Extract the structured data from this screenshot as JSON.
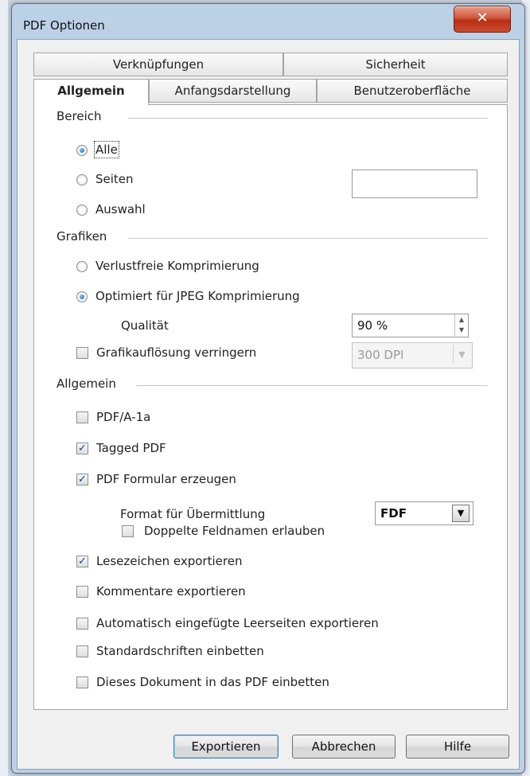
{
  "window": {
    "title": "PDF Optionen",
    "close_glyph": "✕"
  },
  "tabs": {
    "row1": [
      "Verknüpfungen",
      "Sicherheit"
    ],
    "row2": [
      "Allgemein",
      "Anfangsdarstellung",
      "Benutzeroberfläche"
    ],
    "active": "Allgemein"
  },
  "bereich": {
    "title": "Bereich",
    "alle": "Alle",
    "seiten": "Seiten",
    "auswahl": "Auswahl",
    "selected": "Alle",
    "seiten_value": ""
  },
  "grafiken": {
    "title": "Grafiken",
    "verlustfrei": "Verlustfreie Komprimierung",
    "jpeg": "Optimiert für JPEG Komprimierung",
    "selected": "jpeg",
    "qualitaet_label": "Qualität",
    "qualitaet_value": "90 %",
    "aufloesung_label": "Grafikauflösung verringern",
    "aufloesung_checked": false,
    "aufloesung_value": "300 DPI"
  },
  "allgemein": {
    "title": "Allgemein",
    "pdfa": {
      "label": "PDF/A-1a",
      "checked": false
    },
    "tagged": {
      "label": "Tagged PDF",
      "checked": true
    },
    "formular": {
      "label": "PDF Formular erzeugen",
      "checked": true
    },
    "format_label": "Format für Übermittlung",
    "format_value": "FDF",
    "doppelte": {
      "label": "Doppelte Feldnamen erlauben",
      "checked": false
    },
    "lesezeichen": {
      "label": "Lesezeichen exportieren",
      "checked": true
    },
    "kommentare": {
      "label": "Kommentare exportieren",
      "checked": false
    },
    "leerseiten": {
      "label": "Automatisch eingefügte Leerseiten exportieren",
      "checked": false
    },
    "schriften": {
      "label": "Standardschriften einbetten",
      "checked": false
    },
    "dokument": {
      "label": "Dieses Dokument in das PDF einbetten",
      "checked": false
    }
  },
  "buttons": {
    "exportieren": "Exportieren",
    "abbrechen": "Abbrechen",
    "hilfe": "Hilfe"
  },
  "glyphs": {
    "check": "✓",
    "spin_up": "▲",
    "spin_down": "▼",
    "dropdown": "▼"
  },
  "colors": {
    "close_red": "#c94a2c",
    "radio_blue": "#1b5fb2",
    "titlebar": "#bcd0e6"
  }
}
